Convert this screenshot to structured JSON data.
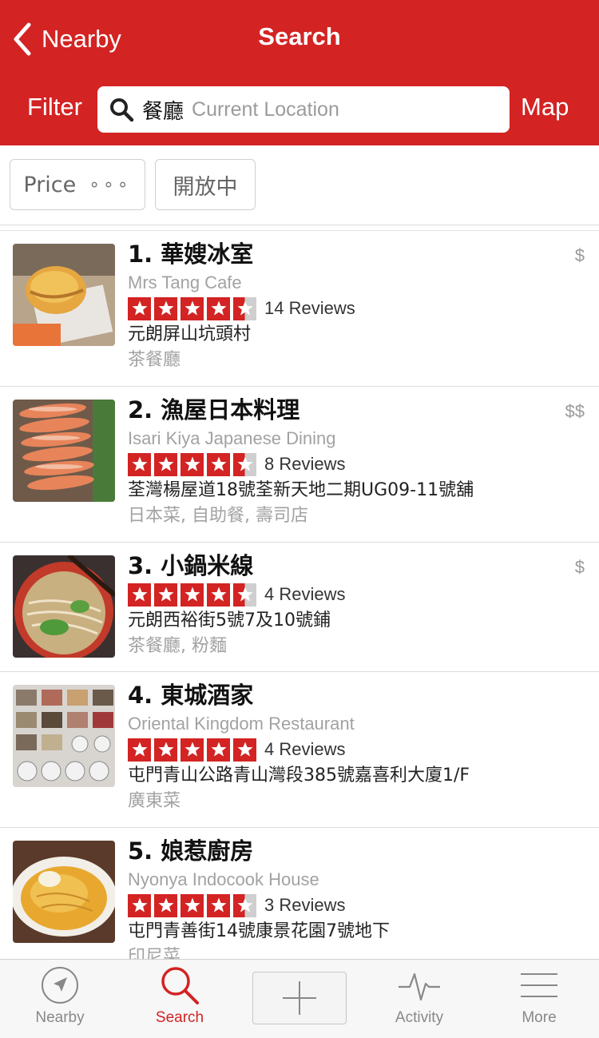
{
  "header": {
    "back_label": "Nearby",
    "title": "Search",
    "filter_label": "Filter",
    "map_label": "Map",
    "search_term": "餐廳",
    "location_placeholder": "Current Location"
  },
  "chips": {
    "price_label": "Price",
    "price_dots": "∘∘∘",
    "open_label": "開放中"
  },
  "results": [
    {
      "name": "1. 華嫂冰室",
      "subname": "Mrs Tang Cafe",
      "rating": 4.5,
      "reviews": "14 Reviews",
      "address": "元朗屏山坑頭村",
      "category": "茶餐廳",
      "price": "$"
    },
    {
      "name": "2. 漁屋日本料理",
      "subname": "Isari Kiya Japanese Dining",
      "rating": 4.5,
      "reviews": "8 Reviews",
      "address": "荃灣楊屋道18號荃新天地二期UG09-11號舖",
      "category": "日本菜, 自助餐, 壽司店",
      "price": "$$"
    },
    {
      "name": "3. 小鍋米線",
      "subname": "",
      "rating": 4.5,
      "reviews": "4 Reviews",
      "address": "元朗西裕街5號7及10號鋪",
      "category": "茶餐廳, 粉麵",
      "price": "$"
    },
    {
      "name": "4. 東城酒家",
      "subname": "Oriental Kingdom Restaurant",
      "rating": 5,
      "reviews": "4 Reviews",
      "address": "屯門青山公路青山灣段385號嘉喜利大廈1/F",
      "category": "廣東菜",
      "price": ""
    },
    {
      "name": "5. 娘惹廚房",
      "subname": "Nyonya Indocook House",
      "rating": 4.5,
      "reviews": "3 Reviews",
      "address": "屯門青善街14號康景花園7號地下",
      "category": "印尼菜",
      "price": ""
    }
  ],
  "tabbar": {
    "nearby": "Nearby",
    "search": "Search",
    "activity": "Activity",
    "more": "More"
  },
  "colors": {
    "brand": "#d32323",
    "star_empty": "#cfcfcf"
  }
}
